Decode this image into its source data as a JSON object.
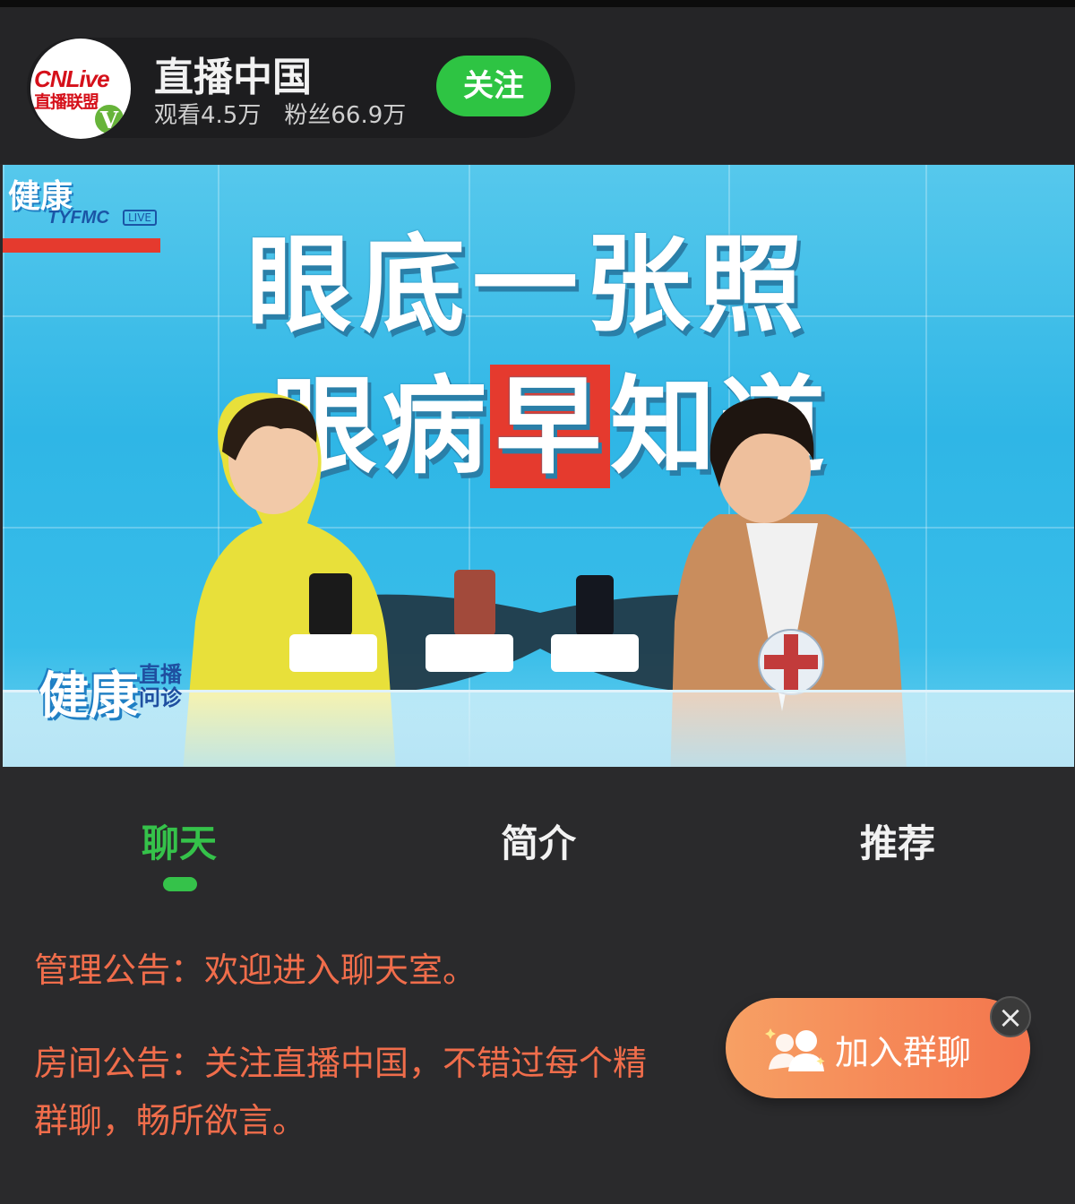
{
  "header": {
    "logo_text_line1": "CNLive",
    "logo_text_line2": "直播联盟",
    "logo_badge": "V",
    "channel_name": "直播中国",
    "views": "观看4.5万",
    "fans": "粉丝66.9万",
    "follow_label": "关注"
  },
  "video": {
    "headline_line1": "眼底一张照",
    "headline_line2_pre": "眼病",
    "headline_line2_hl": "早",
    "headline_line2_post": "知道",
    "show_name_big": "健康",
    "show_name_small": "直播问诊",
    "tyfmc": "TYFMC",
    "live": "LIVE"
  },
  "tabs": [
    {
      "label": "聊天",
      "active": true
    },
    {
      "label": "简介",
      "active": false
    },
    {
      "label": "推荐",
      "active": false
    }
  ],
  "chat": {
    "admin_notice": "管理公告：欢迎进入聊天室。",
    "room_notice_line1": "房间公告：关注直播中国，不错过每个精",
    "room_notice_line2": "群聊，畅所欲言。"
  },
  "join_group": {
    "label": "加入群聊",
    "close": "×"
  },
  "colors": {
    "accent_green": "#35c24a",
    "notice_orange": "#f06d4b",
    "join_gradient_start": "#f7a064",
    "join_gradient_end": "#f4754d"
  }
}
